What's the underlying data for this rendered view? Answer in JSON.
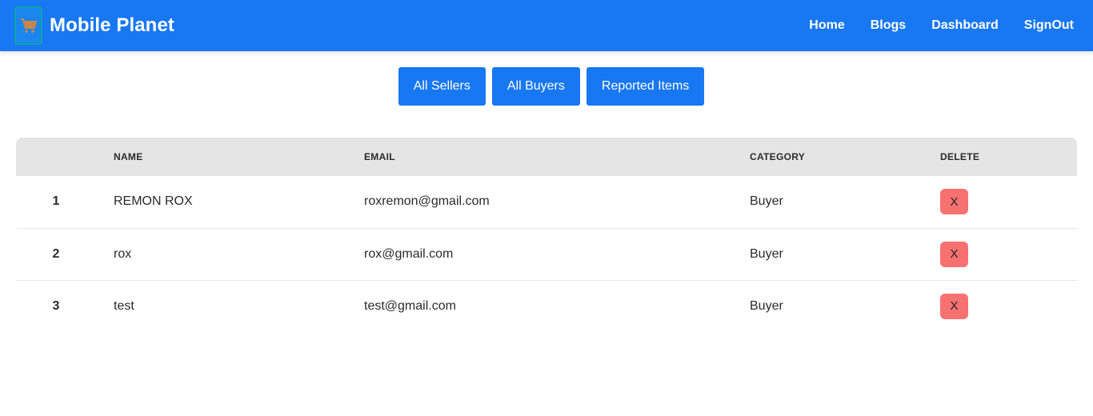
{
  "header": {
    "brand": "Mobile Planet",
    "logo_icon": "shopping-cart-icon",
    "nav": [
      {
        "label": "Home"
      },
      {
        "label": "Blogs"
      },
      {
        "label": "Dashboard"
      },
      {
        "label": "SignOut"
      }
    ],
    "colors": {
      "bar": "#1877f2",
      "text": "#ffffff"
    }
  },
  "tabs": [
    {
      "label": "All Sellers"
    },
    {
      "label": "All Buyers"
    },
    {
      "label": "Reported Items"
    }
  ],
  "table": {
    "columns": [
      "",
      "NAME",
      "EMAIL",
      "CATEGORY",
      "DELETE"
    ],
    "rows": [
      {
        "index": "1",
        "name": "REMON ROX",
        "email": "roxremon@gmail.com",
        "category": "Buyer",
        "delete_label": "X"
      },
      {
        "index": "2",
        "name": "rox",
        "email": "rox@gmail.com",
        "category": "Buyer",
        "delete_label": "X"
      },
      {
        "index": "3",
        "name": "test",
        "email": "test@gmail.com",
        "category": "Buyer",
        "delete_label": "X"
      }
    ],
    "colors": {
      "header_bg": "#e5e5e5",
      "delete_button": "#f87171"
    }
  }
}
